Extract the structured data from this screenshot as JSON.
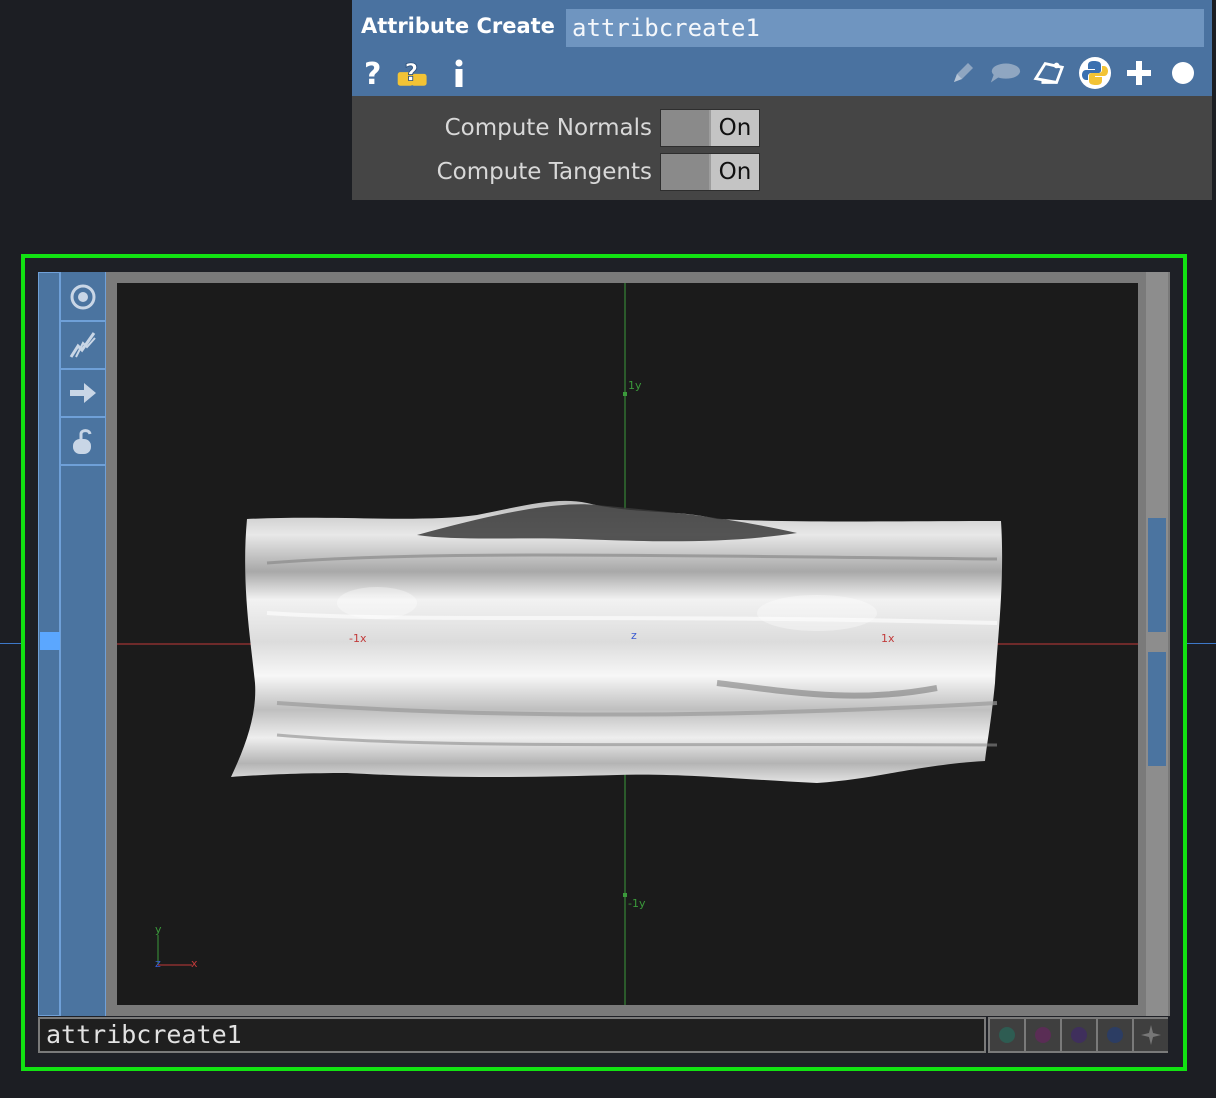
{
  "header": {
    "op_type": "Attribute Create",
    "op_name": "attribcreate1",
    "left_icons": [
      "help-icon",
      "python-help-icon",
      "info-icon"
    ],
    "right_icons": [
      "edit-icon",
      "comment-icon",
      "docked-icon",
      "python-icon",
      "add-icon",
      "viewer-dot-icon"
    ]
  },
  "params": [
    {
      "label": "Compute Normals",
      "value": "On"
    },
    {
      "label": "Compute Tangents",
      "value": "On"
    }
  ],
  "viewer": {
    "tools": [
      "camera-home-icon",
      "wireframe-icon",
      "arrow-right-icon",
      "lock-icon"
    ],
    "axes": {
      "pos_y": "1y",
      "neg_y": "-1y",
      "neg_x": "-1x",
      "pos_x": "1x",
      "center": "z"
    },
    "gizmo": {
      "y": "y",
      "x": "x",
      "z": "z"
    },
    "node_name": "attribcreate1",
    "flags": [
      {
        "name": "flag-teal",
        "color": "#2e5c52"
      },
      {
        "name": "flag-magenta",
        "color": "#5a2d55"
      },
      {
        "name": "flag-purple",
        "color": "#3f2f5c"
      },
      {
        "name": "flag-blue",
        "color": "#2c3d63"
      }
    ],
    "colors": {
      "frame": "#12e212",
      "accent": "#4b74a0",
      "x_axis": "#c23a3a",
      "y_axis": "#3b9a3b"
    }
  }
}
